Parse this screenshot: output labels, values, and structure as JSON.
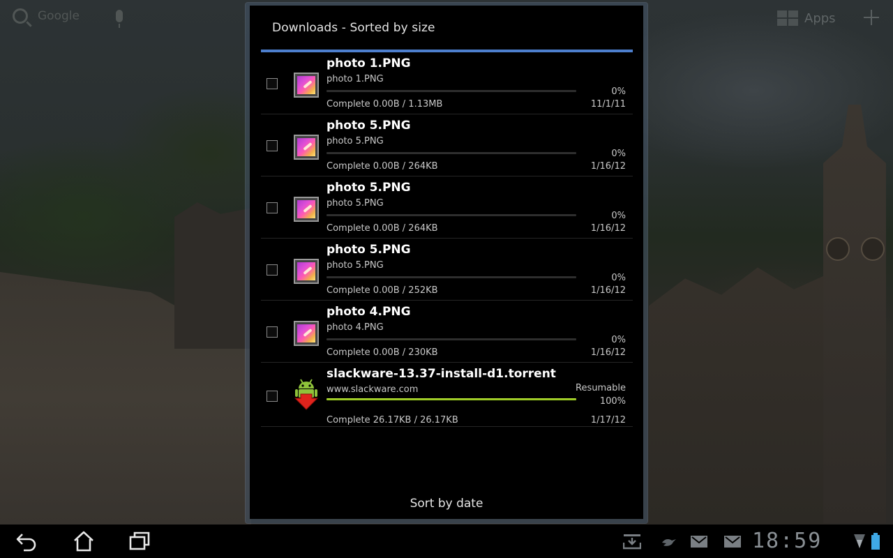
{
  "launcher": {
    "search_label": "Google",
    "apps_label": "Apps"
  },
  "dialog": {
    "title": "Downloads - Sorted by size",
    "accent_color": "#4d7fce",
    "sort_button_label": "Sort by date"
  },
  "downloads": [
    {
      "title": "photo 1.PNG",
      "subtitle": "photo 1.PNG",
      "status": "Complete  0.00B  /  1.13MB",
      "percent": "0%",
      "progress_fraction": 0,
      "date": "11/1/11",
      "icon": "image-file-icon",
      "checked": false
    },
    {
      "title": "photo 5.PNG",
      "subtitle": "photo 5.PNG",
      "status": "Complete  0.00B  /  264KB",
      "percent": "0%",
      "progress_fraction": 0,
      "date": "1/16/12",
      "icon": "image-file-icon",
      "checked": false
    },
    {
      "title": "photo 5.PNG",
      "subtitle": "photo 5.PNG",
      "status": "Complete  0.00B  /  264KB",
      "percent": "0%",
      "progress_fraction": 0,
      "date": "1/16/12",
      "icon": "image-file-icon",
      "checked": false
    },
    {
      "title": "photo 5.PNG",
      "subtitle": "photo 5.PNG",
      "status": "Complete  0.00B  /  252KB",
      "percent": "0%",
      "progress_fraction": 0,
      "date": "1/16/12",
      "icon": "image-file-icon",
      "checked": false
    },
    {
      "title": "photo 4.PNG",
      "subtitle": "photo 4.PNG",
      "status": "Complete  0.00B  /  230KB",
      "percent": "0%",
      "progress_fraction": 0,
      "date": "1/16/12",
      "icon": "image-file-icon",
      "checked": false
    },
    {
      "title": "slackware-13.37-install-d1.torrent",
      "subtitle": "www.slackware.com",
      "resumable": "Resumable",
      "status": "Complete  26.17KB  /  26.17KB",
      "percent": "100%",
      "progress_fraction": 1,
      "date": "1/17/12",
      "icon": "android-download-icon",
      "checked": false
    }
  ],
  "navbar": {
    "clock": "18:59",
    "buttons": [
      "back-icon",
      "home-icon",
      "recent-apps-icon"
    ],
    "status_icons": [
      "download-notification-icon",
      "bird-notification-icon",
      "gmail-icon",
      "gmail-icon",
      "wifi-icon",
      "battery-icon"
    ]
  }
}
